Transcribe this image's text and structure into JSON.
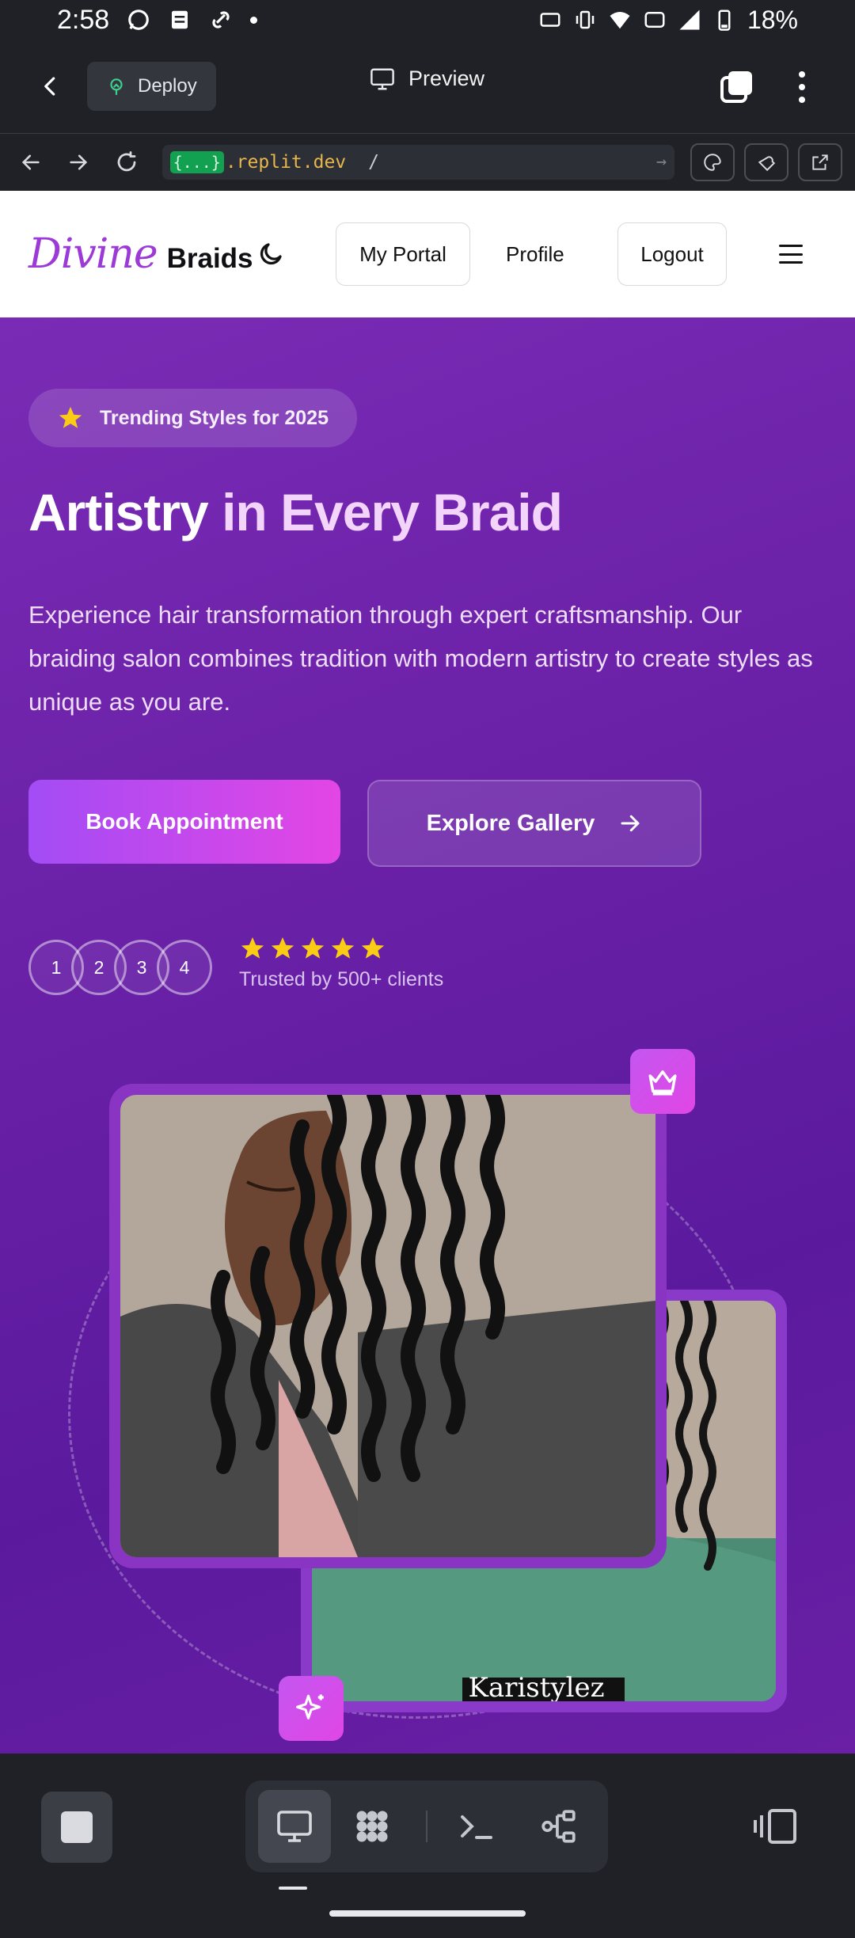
{
  "status_bar": {
    "time": "2:58",
    "battery": "18%"
  },
  "replit": {
    "deploy_label": "Deploy",
    "preview_label": "Preview",
    "url_badge": "{...}",
    "url_domain": ".replit.dev",
    "url_path": "/"
  },
  "site": {
    "logo_script": "Divine",
    "logo_bold": "Braids",
    "nav": {
      "portal": "My Portal",
      "profile": "Profile",
      "logout": "Logout"
    },
    "hero": {
      "pill": "Trending Styles for 2025",
      "headline_accent": "Artistry",
      "headline_rest": " in Every Braid",
      "lead": "Experience hair transformation through expert craftsmanship. Our braiding salon combines tradition with modern artistry to create styles as unique as you are.",
      "cta_primary": "Book Appointment",
      "cta_secondary": "Explore Gallery",
      "avatars": [
        "1",
        "2",
        "3",
        "4"
      ],
      "rating_stars": 5,
      "trusted": "Trusted by 500+ clients",
      "photo_caption_back": "Karistylez_"
    }
  },
  "colors": {
    "hero_purple": "#6b21a8",
    "accent_pink": "#e346e4",
    "logo_purple": "#9b3ad6",
    "star_yellow": "#facc15"
  },
  "icons": [
    "back-icon",
    "deploy-icon",
    "monitor-icon",
    "tabs-icon",
    "kebab-icon",
    "arrow-left-icon",
    "arrow-right-icon",
    "reload-icon",
    "palette-icon",
    "wrench-icon",
    "external-link-icon",
    "moon-icon",
    "menu-icon",
    "star-icon",
    "arrow-icon",
    "crown-icon",
    "sparkle-icon",
    "stop-icon",
    "desktop-icon",
    "apps-icon",
    "terminal-icon",
    "git-icon",
    "split-view-icon"
  ]
}
